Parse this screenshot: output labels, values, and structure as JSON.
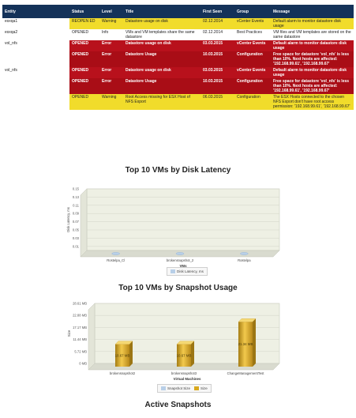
{
  "table": {
    "headers": [
      "Entity",
      "Status",
      "Level",
      "Title",
      "First Seen",
      "Group",
      "Message"
    ],
    "rows": [
      {
        "style": "warn",
        "entity": "esxqa1",
        "status": "REOPEN ED",
        "level": "Warning",
        "title": "Datastore usage on disk",
        "first_seen": "02.12.2014",
        "group": "vCenter Events",
        "message": "Default alarm to monitor datastore disk usage"
      },
      {
        "style": "white",
        "entity": "esxqa2",
        "status": "OPENED",
        "level": "Info",
        "title": "VMs and VM templates share the same datastore",
        "first_seen": "02.12.2014",
        "group": "Best Practices",
        "message": "VM files and VM templates are stored on the same datastore"
      },
      {
        "style": "err",
        "entity": "vol_nfs",
        "status": "OPENED",
        "level": "Error",
        "title": "Datastore usage on disk",
        "first_seen": "03.03.2015",
        "group": "vCenter Events",
        "message": "Default alarm to monitor datastore disk usage"
      },
      {
        "style": "err2",
        "entity": "",
        "status": "OPENED",
        "level": "Error",
        "title": "Datastore Usage",
        "first_seen": "10.03.2015",
        "group": "Configuration",
        "message": "Free space for datastore 'vol_nfs' is less than 10%. Next hosts are affected: '192.168.99.61', '192.168.99.67'"
      },
      {
        "style": "err",
        "entity": "vol_nfs",
        "status": "OPENED",
        "level": "Error",
        "title": "Datastore usage on disk",
        "first_seen": "03.03.2015",
        "group": "vCenter Events",
        "message": "Default alarm to monitor datastore disk usage"
      },
      {
        "style": "err2",
        "entity": "",
        "status": "OPENED",
        "level": "Error",
        "title": "Datastore Usage",
        "first_seen": "10.03.2015",
        "group": "Configuration",
        "message": "Free space for datastore 'vol_nfs' is less than 10%. Next hosts are affected: '192.168.99.61', '192.168.99.67'"
      },
      {
        "style": "warn",
        "entity": "",
        "status": "OPENED",
        "level": "Warning",
        "title": "Root Access missing for ESX Host of NFS Export",
        "first_seen": "06.03.2015",
        "group": "Configuration",
        "message": "The ESX Hosts connected to the chosen NFS Export don't have root access permission: '192.168.99.61', '192.168.99.67'"
      }
    ]
  },
  "colors": {
    "header": "#143259",
    "warning": "#f1dc2b",
    "error": "#b8111c",
    "bar": "#d9a91e",
    "plot_bg": "#eef0e4"
  },
  "sections": {
    "disk_latency_title": "Top 10 VMs by Disk Latency",
    "snapshot_title": "Top 10 VMs by Snapshot Usage",
    "active_snapshots_title": "Active Snapshots"
  },
  "chart_data": [
    {
      "type": "bar",
      "ylabel": "Disk Latency, ms",
      "xlabel": "VMs",
      "ylim": [
        0,
        0.15
      ],
      "yticks": [
        "0.15",
        "0.13",
        "0.11",
        "0.09",
        "0.07",
        "0.05",
        "0.03",
        "0.01"
      ],
      "categories": [
        "Rostelpa_Cl",
        "brokensnapshot_2",
        "Rostelpa"
      ],
      "series": [
        {
          "name": "Disk Latency, ms",
          "values": [
            0,
            0,
            0
          ]
        }
      ],
      "legend_position": "bottom"
    },
    {
      "type": "bar",
      "ylabel": "Size",
      "xlabel": "Virtual Machines",
      "ylim": [
        0,
        28.61
      ],
      "yticks": [
        "28.61 MB",
        "22.88 MB",
        "17.17 MB",
        "11.44 MB",
        "5.72 MB",
        "0 MB"
      ],
      "categories": [
        "brokensnapshot2",
        "brokensnapshot3",
        "ChangeManagementTest"
      ],
      "series": [
        {
          "name": "Snapshot Size",
          "values": [
            10.67,
            10.67,
            21.34
          ],
          "labels": [
            "10.67 MB",
            "10.67 MB",
            "21.34 MB"
          ]
        }
      ],
      "legend": [
        "Snapshot Size",
        "Size"
      ],
      "legend_position": "bottom"
    }
  ]
}
